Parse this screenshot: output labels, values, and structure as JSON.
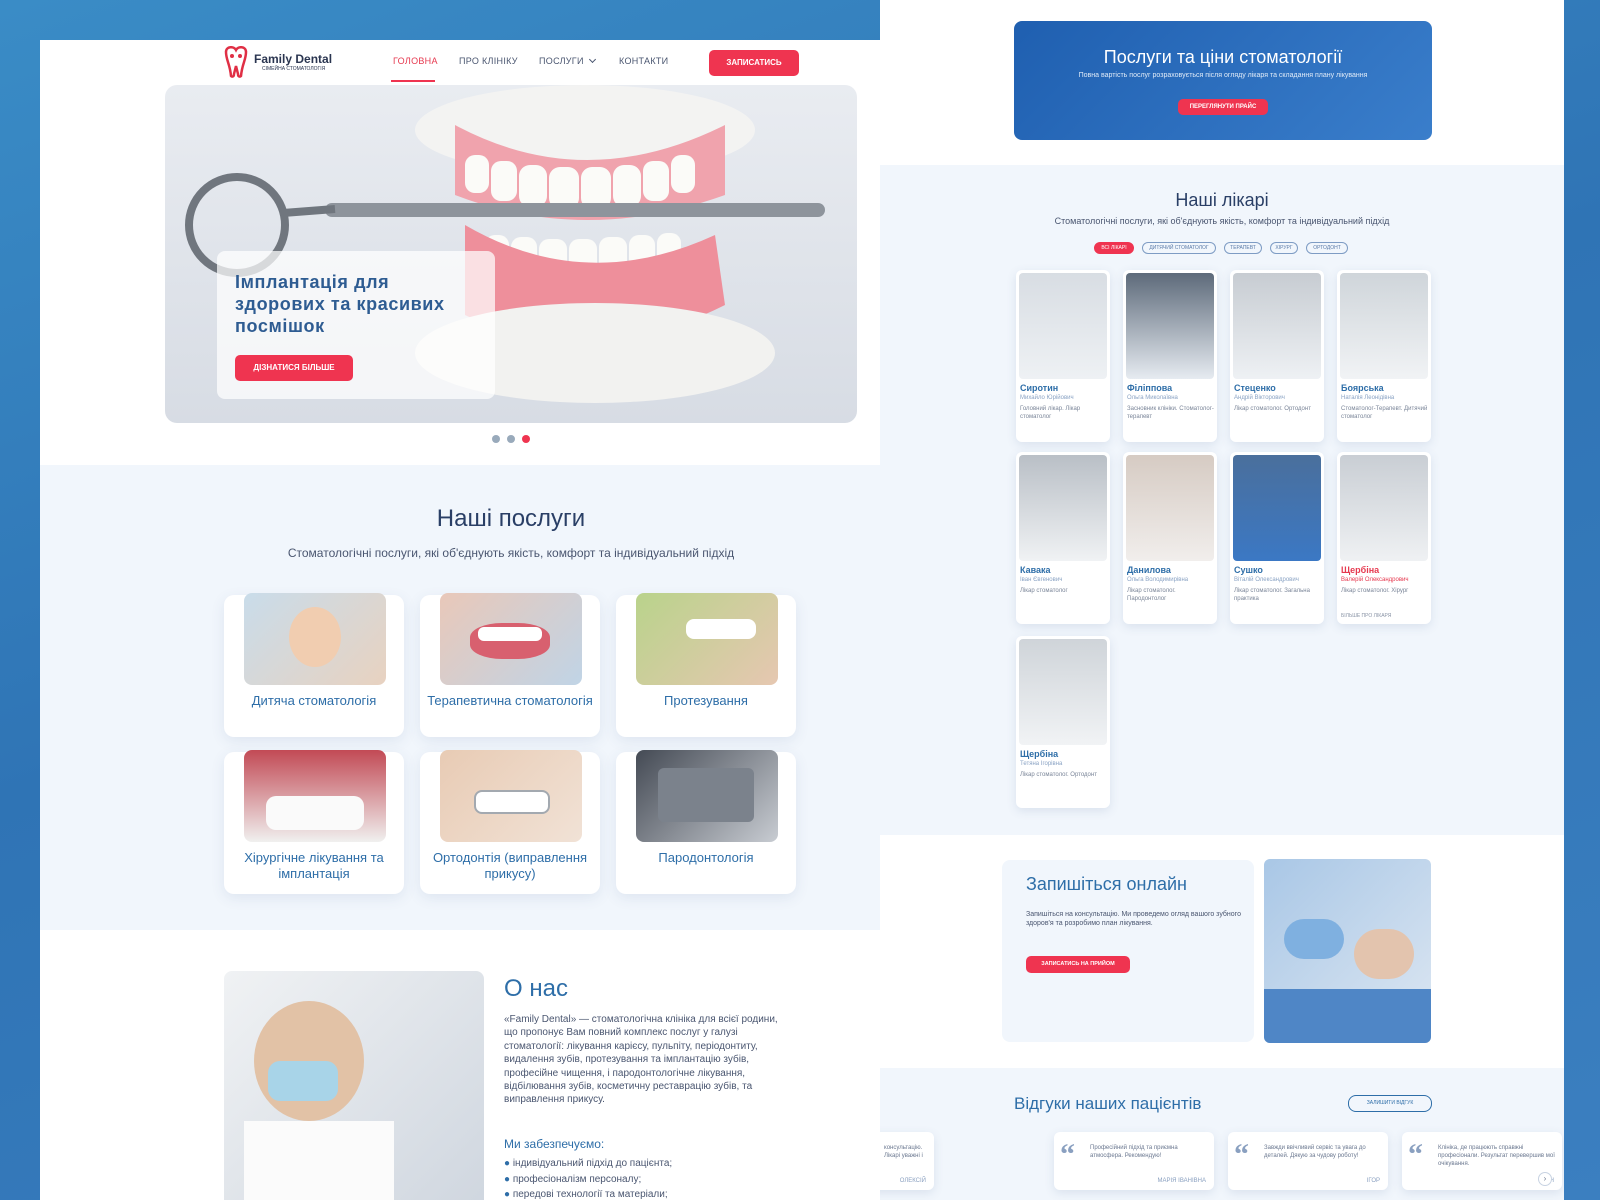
{
  "brand": {
    "name": "Family Dental",
    "tagline": "СІМЕЙНА СТОМАТОЛОГІЯ",
    "accent": "#ef3450",
    "blue": "#2e6ea8"
  },
  "nav": {
    "items": [
      "ГОЛОВНА",
      "ПРО КЛІНІКУ",
      "ПОСЛУГИ",
      "КОНТАКТИ"
    ],
    "active": "ГОЛОВНА",
    "cta": "ЗАПИСАТИСЬ"
  },
  "hero": {
    "title": "Імплантація для здорових та красивих посмішок",
    "button": "ДІЗНАТИСЯ БІЛЬШЕ",
    "slides": 3,
    "active_slide": 3
  },
  "services": {
    "title": "Наші послуги",
    "subtitle": "Стоматологічні послуги, які об'єднують якість, комфорт та індивідуальний підхід",
    "items": [
      "Дитяча стоматологія",
      "Терапевтична стоматологія",
      "Протезування",
      "Хірургічне лікування та імплантація",
      "Ортодонтія (виправлення прикусу)",
      "Пародонтологія"
    ]
  },
  "about": {
    "title": "О нас",
    "text": "«Family Dental» — стоматологічна клініка для всієї родини, що пропонує Вам повний комплекс послуг у галузі стоматології: лікування карієсу, пульпіту, періодонтиту, видалення зубів, протезування та імплантацію зубів, професійне чищення, і пародонтологічне лікування, відбілювання зубів, косметичну реставрацію зубів, та виправлення прикусу.",
    "subtitle": "Ми забезпечуємо:",
    "bullets": [
      "індивідуальний підхід до пацієнта;",
      "професіоналізм персоналу;",
      "передові технології та матеріали;"
    ]
  },
  "prices": {
    "title": "Послуги та ціни стоматології",
    "text": "Повна вартість послуг розраховується після огляду лікаря та складання плану лікування",
    "button": "ПЕРЕГЛЯНУТИ ПРАЙС"
  },
  "doctors": {
    "title": "Наші лікарі",
    "subtitle": "Стоматологічні послуги, які об'єднують якість, комфорт та індивідуальний підхід",
    "filters": [
      "ВСІ ЛІКАРІ",
      "ДИТЯЧИЙ СТОМАТОЛОГ",
      "ТЕРАПЕВТ",
      "ХІРУРГ",
      "ОРТОДОНТ"
    ],
    "list": [
      {
        "surname": "Сиротин",
        "name": "Михайло Юрійович",
        "role": "Головний лікар. Лікар стоматолог"
      },
      {
        "surname": "Філіппова",
        "name": "Ольга Миколаївна",
        "role": "Засновник клініки. Стоматолог-терапевт"
      },
      {
        "surname": "Стеценко",
        "name": "Андрій Вікторович",
        "role": "Лікар стоматолог. Ортодонт"
      },
      {
        "surname": "Боярська",
        "name": "Наталія Леонідівна",
        "role": "Стоматолог-Терапевт. Дитячий стоматолог"
      },
      {
        "surname": "Кавака",
        "name": "Іван Євгенович",
        "role": "Лікар стоматолог"
      },
      {
        "surname": "Данилова",
        "name": "Ольга Володимирівна",
        "role": "Лікар стоматолог. Пародонтолог"
      },
      {
        "surname": "Сушко",
        "name": "Віталій Олександрович",
        "role": "Лікар стоматолог. Загальна практика"
      },
      {
        "surname": "Щербіна",
        "name": "Валерій Олександрович",
        "role": "Лікар стоматолог. Хірург",
        "more": "БІЛЬШЕ ПРО ЛІКАРЯ"
      },
      {
        "surname": "Щербіна",
        "name": "Тетяна Ігорівна",
        "role": "Лікар стоматолог. Ортодонт"
      }
    ]
  },
  "booking": {
    "title": "Запишіться онлайн",
    "text": "Запишіться на консультацію. Ми проведемо огляд вашого зубного здоров'я та розробимо план лікування.",
    "button": "ЗАПИСАТИСЬ НА ПРИЙОМ"
  },
  "reviews": {
    "title": "Відгуки наших пацієнтів",
    "button": "ЗАЛИШИТИ ВІДГУК",
    "items": [
      {
        "text": "Професійний підхід та приємна атмосфера. Рекомендую!",
        "author": "МАРІЯ ІВАНІВНА"
      },
      {
        "text": "Завжди ввічливий сервіс та увага до деталей. Дякую за чудову роботу!",
        "author": "ІГОР"
      },
      {
        "text": "Клініка, де працюють справжні професіонали. Результат перевершив мої очікування.",
        "author": "АН"
      }
    ],
    "partial_text": "консультацію. Лікарі уважні і",
    "partial_author": "ОЛЕКСІЙ"
  }
}
